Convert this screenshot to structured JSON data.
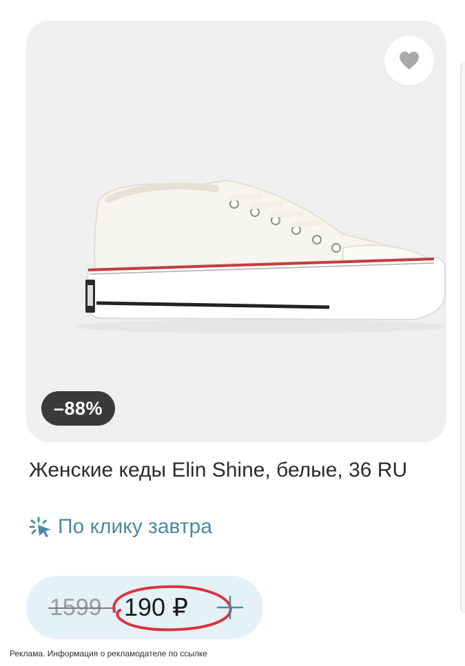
{
  "product": {
    "discount": "–88%",
    "title": "Женские кеды Elin Shine, белые, 36 RU",
    "delivery": "По клику завтра",
    "old_price": "1599",
    "price": "190 ₽"
  },
  "icons": {
    "favorite": "heart-icon",
    "delivery": "sparkle-cursor-icon",
    "add": "plus-icon"
  },
  "colors": {
    "delivery_accent": "#4a8aa0",
    "price_pill_bg": "#e4f1f7",
    "badge_bg": "#3a3a3a",
    "annotation_red": "#d9333f"
  },
  "footer": {
    "ad_note": "Реклама. Информация о рекламодателе по ссылке"
  }
}
